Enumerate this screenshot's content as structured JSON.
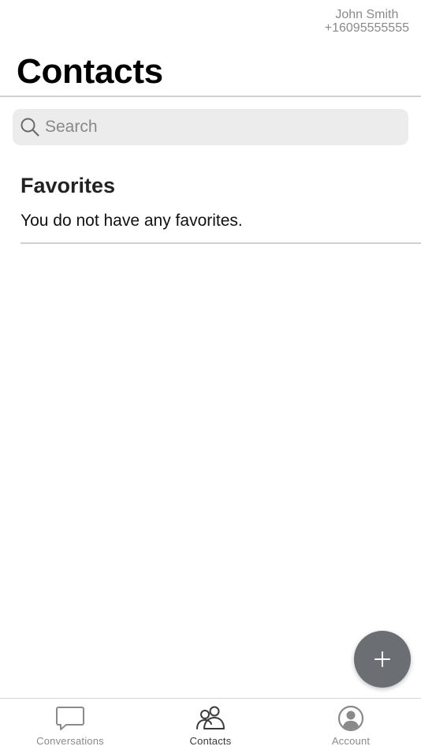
{
  "account": {
    "name": "John Smith",
    "phone": "+16095555555"
  },
  "header": {
    "title": "Contacts"
  },
  "search": {
    "placeholder": "Search",
    "icon": "search-icon"
  },
  "favorites": {
    "title": "Favorites",
    "empty_message": "You do not have any favorites."
  },
  "fab": {
    "icon": "plus-icon"
  },
  "tabs": [
    {
      "label": "Conversations",
      "icon": "chat-bubble-icon",
      "active": false
    },
    {
      "label": "Contacts",
      "icon": "people-icon",
      "active": true
    },
    {
      "label": "Account",
      "icon": "user-circle-icon",
      "active": false
    }
  ],
  "colors": {
    "fab_bg": "#6b6e72",
    "search_bg": "#ececec",
    "divider": "#d0d0d0",
    "inactive": "#8a8a8a",
    "active": "#3a3a3a"
  }
}
